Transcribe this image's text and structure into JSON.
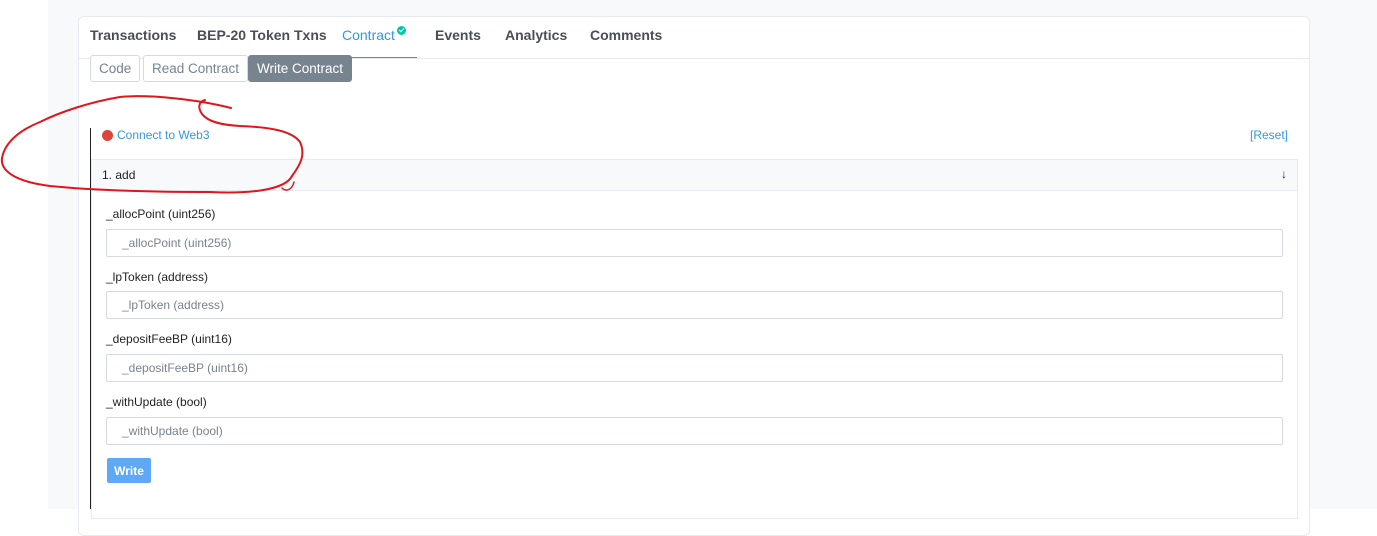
{
  "tabs": [
    {
      "label": "Transactions"
    },
    {
      "label": "BEP-20 Token Txns"
    },
    {
      "label": "Contract",
      "active": true,
      "verified": true
    },
    {
      "label": "Events"
    },
    {
      "label": "Analytics"
    },
    {
      "label": "Comments"
    }
  ],
  "subtabs": [
    {
      "label": "Code"
    },
    {
      "label": "Read Contract"
    },
    {
      "label": "Write Contract",
      "active": true
    }
  ],
  "connect": {
    "label": "Connect to Web3",
    "status_color": "#de4437"
  },
  "reset_label": "[Reset]",
  "function": {
    "title": "1. add",
    "toggle_icon": "arrow-down",
    "fields": [
      {
        "label": "_allocPoint (uint256)",
        "placeholder": "_allocPoint (uint256)",
        "value": ""
      },
      {
        "label": "_lpToken (address)",
        "placeholder": "_lpToken (address)",
        "value": ""
      },
      {
        "label": "_depositFeeBP (uint16)",
        "placeholder": "_depositFeeBP (uint16)",
        "value": ""
      },
      {
        "label": "_withUpdate (bool)",
        "placeholder": "_withUpdate (bool)",
        "value": ""
      }
    ],
    "write_label": "Write"
  },
  "colors": {
    "accent": "#3498db",
    "verified": "#00c9a7",
    "write_button": "#5fa8f5",
    "annotation": "#e0161b"
  }
}
